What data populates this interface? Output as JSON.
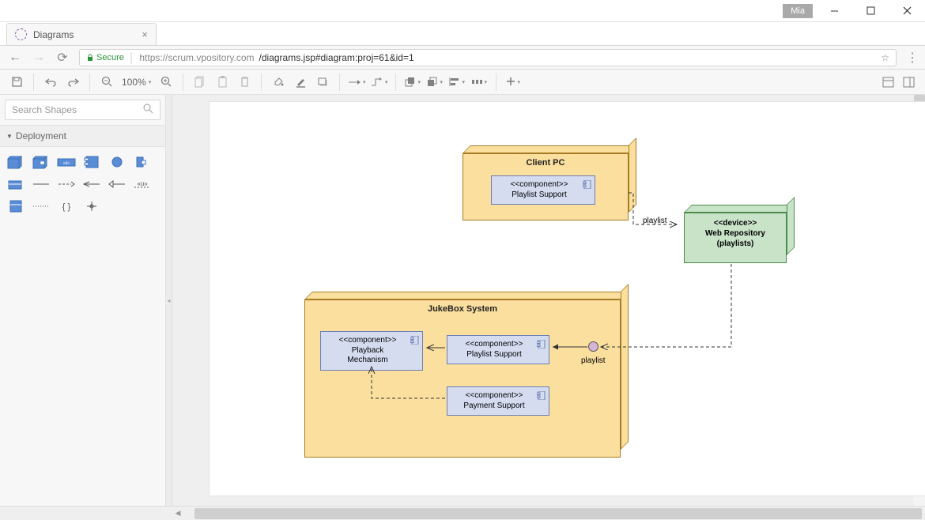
{
  "window": {
    "user": "Mia"
  },
  "tab": {
    "title": "Diagrams"
  },
  "address": {
    "secure": "Secure",
    "url_host": "https://scrum.vpository.com",
    "url_path": "/diagrams.jsp#diagram:proj=61&id=1"
  },
  "toolbar": {
    "zoom": "100%"
  },
  "sidebar": {
    "search_placeholder": "Search Shapes",
    "panel": "Deployment"
  },
  "diagram": {
    "client_pc": {
      "title": "Client PC"
    },
    "jukebox": {
      "title": "JukeBox System"
    },
    "webrepo": {
      "stereo": "<<device>>",
      "name": "Web Repository",
      "sub": "(playlists)"
    },
    "components": {
      "playlist_support_client": {
        "stereo": "<<component>>",
        "name": "Playlist Support"
      },
      "playback": {
        "stereo": "<<component>>",
        "name": "Playback",
        "name2": "Mechanism"
      },
      "playlist_support_jb": {
        "stereo": "<<component>>",
        "name": "Playlist Support"
      },
      "payment": {
        "stereo": "<<component>>",
        "name": "Payment Support"
      }
    },
    "labels": {
      "playlist_link": "playlist",
      "playlist_port": "playlist"
    }
  }
}
